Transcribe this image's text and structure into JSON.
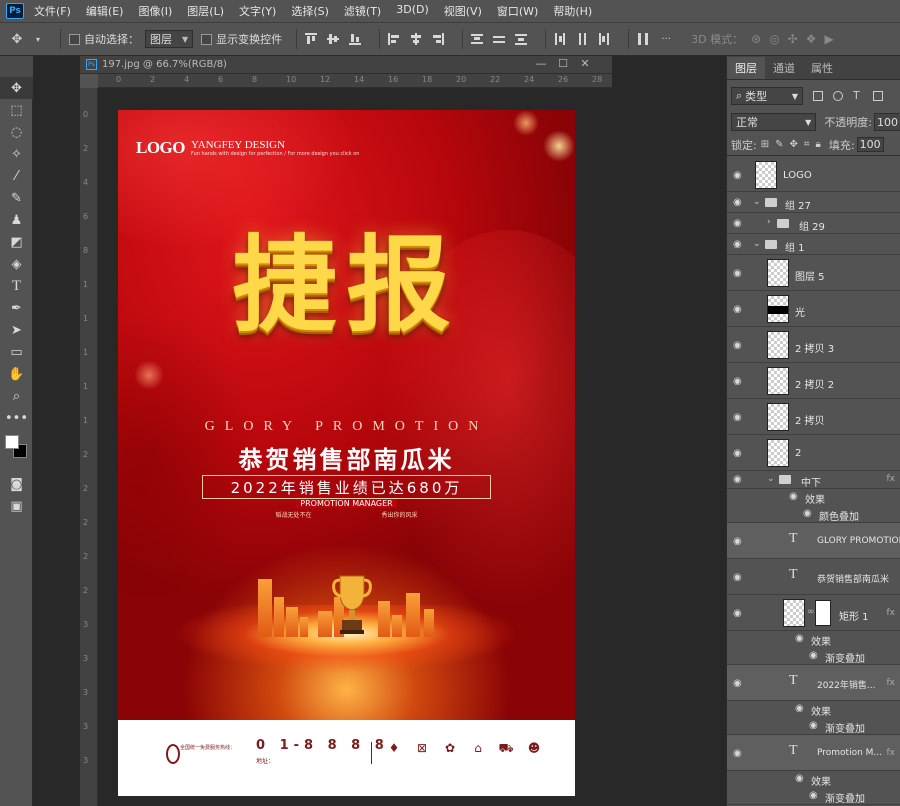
{
  "app": {
    "logo": "Ps"
  },
  "menu": [
    "文件(F)",
    "编辑(E)",
    "图像(I)",
    "图层(L)",
    "文字(Y)",
    "选择(S)",
    "滤镜(T)",
    "3D(D)",
    "视图(V)",
    "窗口(W)",
    "帮助(H)"
  ],
  "options": {
    "auto_select_label": "自动选择：",
    "auto_select_value": "图层",
    "show_transform_label": "显示变换控件",
    "mode_3d_label": "3D 模式："
  },
  "document": {
    "tab_title": "197.jpg @ 66.7%(RGB/8)",
    "ruler_top": [
      "0",
      "2",
      "4",
      "6",
      "8",
      "10",
      "12",
      "14",
      "16",
      "18",
      "20",
      "22",
      "24",
      "26",
      "28"
    ],
    "ruler_left": [
      "0",
      "2",
      "4",
      "6",
      "8",
      "1",
      "1",
      "1",
      "1",
      "1",
      "2",
      "2",
      "2",
      "2",
      "2",
      "3",
      "3",
      "3",
      "3",
      "3"
    ]
  },
  "poster": {
    "logo": "LOGO",
    "brand": "YANGFEY DESIGN",
    "brand_sub": "Fun hands with design for perfection / For more design you click on",
    "headline": "捷报",
    "glory": "GLORY PROMOTION",
    "congrats": "恭贺销售部南瓜米",
    "sales": "2022年销售业绩已达680万",
    "promo_manager": "PROMOTION MANAGER",
    "slogan_left": "韬战无处不在",
    "slogan_right": "秀出你的风采",
    "footer_text1": "全国统一免费服务热线：",
    "phone": "0 1-8 8 8 8",
    "address_label": "地址：",
    "colors": {
      "red": "#b5050a",
      "gold": "#ffd84a"
    }
  },
  "panel": {
    "tabs": [
      "图层",
      "通道",
      "属性"
    ],
    "filter_value": "类型",
    "blend_mode": "正常",
    "opacity_label": "不透明度:",
    "opacity_value": "100",
    "lock_label": "锁定:",
    "fill_label": "填充:",
    "fill_value": "100",
    "layers": [
      {
        "name": "LOGO"
      },
      {
        "name": "组 27"
      },
      {
        "name": "组 29"
      },
      {
        "name": "组 1"
      },
      {
        "name": "图层 5"
      },
      {
        "name": "光"
      },
      {
        "name": "2 拷贝 3"
      },
      {
        "name": "2 拷贝 2"
      },
      {
        "name": "2 拷贝"
      },
      {
        "name": "2"
      },
      {
        "name": "中下"
      },
      {
        "name": "效果"
      },
      {
        "name": "颜色叠加"
      },
      {
        "name": "GLORY PROMOTION"
      },
      {
        "name": "恭贺销售部南瓜米"
      },
      {
        "name": "矩形 1"
      },
      {
        "name": "效果"
      },
      {
        "name": "渐变叠加"
      },
      {
        "name": "2022年销售..."
      },
      {
        "name": "效果"
      },
      {
        "name": "渐变叠加"
      },
      {
        "name": "Promotion M..."
      },
      {
        "name": "效果"
      },
      {
        "name": "渐变叠加"
      }
    ]
  }
}
